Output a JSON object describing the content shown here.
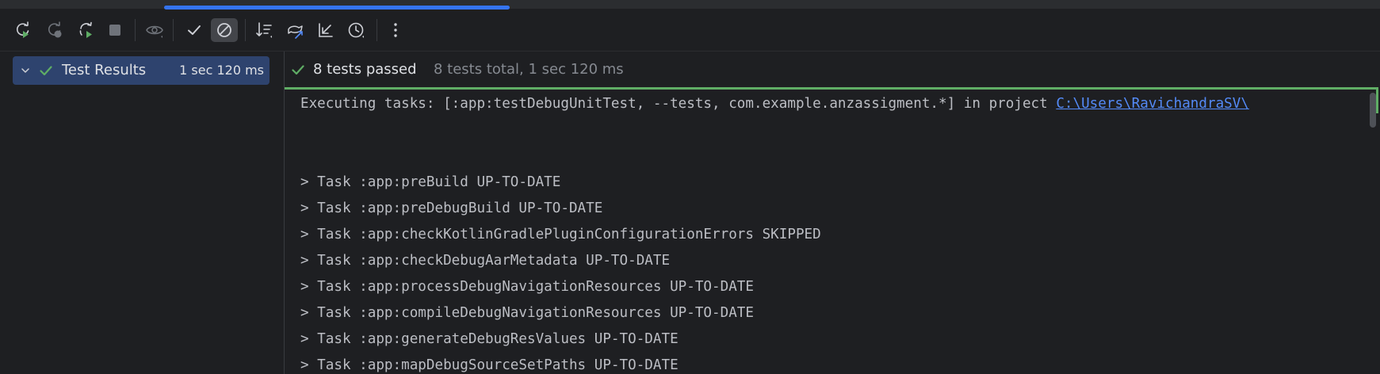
{
  "toolbar": {
    "buttons": [
      {
        "name": "rerun-icon"
      },
      {
        "name": "rerun-failed-icon"
      },
      {
        "name": "toggle-auto-test-icon"
      },
      {
        "name": "stop-icon"
      },
      {
        "name": "show-ignored-icon"
      },
      {
        "name": "show-passed-icon"
      },
      {
        "name": "show-ignored-filter-icon"
      },
      {
        "name": "sort-icon"
      },
      {
        "name": "import-tests-icon"
      },
      {
        "name": "collapse-icon"
      },
      {
        "name": "history-icon"
      },
      {
        "name": "more-options-icon"
      }
    ]
  },
  "tree": {
    "root_label": "Test Results",
    "root_time": "1 sec 120 ms"
  },
  "status": {
    "passed": "8 tests passed",
    "summary": "8 tests total, 1 sec 120 ms"
  },
  "console": {
    "executing_prefix": "Executing tasks: [:app:testDebugUnitTest, --tests, com.example.anzassigment.*] in project ",
    "executing_link": "C:\\Users\\RavichandraSV\\",
    "lines": [
      "> Task :app:preBuild UP-TO-DATE",
      "> Task :app:preDebugBuild UP-TO-DATE",
      "> Task :app:checkKotlinGradlePluginConfigurationErrors SKIPPED",
      "> Task :app:checkDebugAarMetadata UP-TO-DATE",
      "> Task :app:processDebugNavigationResources UP-TO-DATE",
      "> Task :app:compileDebugNavigationResources UP-TO-DATE",
      "> Task :app:generateDebugResValues UP-TO-DATE",
      "> Task :app:mapDebugSourceSetPaths UP-TO-DATE"
    ]
  },
  "colors": {
    "accent": "#3574f0",
    "success": "#5fad65",
    "selection": "#2e436e",
    "link": "#548af7"
  }
}
